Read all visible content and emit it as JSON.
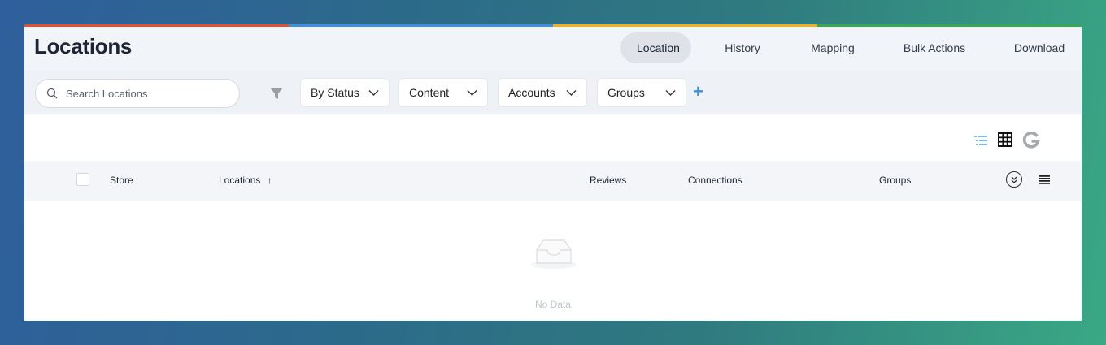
{
  "header": {
    "title": "Locations",
    "tabs": [
      {
        "label": "Location",
        "active": true
      },
      {
        "label": "History",
        "active": false
      },
      {
        "label": "Mapping",
        "active": false
      },
      {
        "label": "Bulk Actions",
        "active": false
      },
      {
        "label": "Download",
        "active": false
      }
    ]
  },
  "accent_colors": [
    "#e2512f",
    "#3d8fe0",
    "#f2b01e",
    "#34a853"
  ],
  "toolbar": {
    "search_placeholder": "Search Locations",
    "filters": [
      {
        "label": "By Status"
      },
      {
        "label": "Content"
      },
      {
        "label": "Accounts"
      },
      {
        "label": "Groups"
      }
    ],
    "add_label": "+"
  },
  "view_icons": [
    "list-view-icon",
    "grid-view-icon",
    "google-icon"
  ],
  "table": {
    "columns": [
      "Store",
      "Locations",
      "Reviews",
      "Connections",
      "Groups"
    ],
    "sort_indicator": "↑",
    "empty_text": "No Data"
  }
}
